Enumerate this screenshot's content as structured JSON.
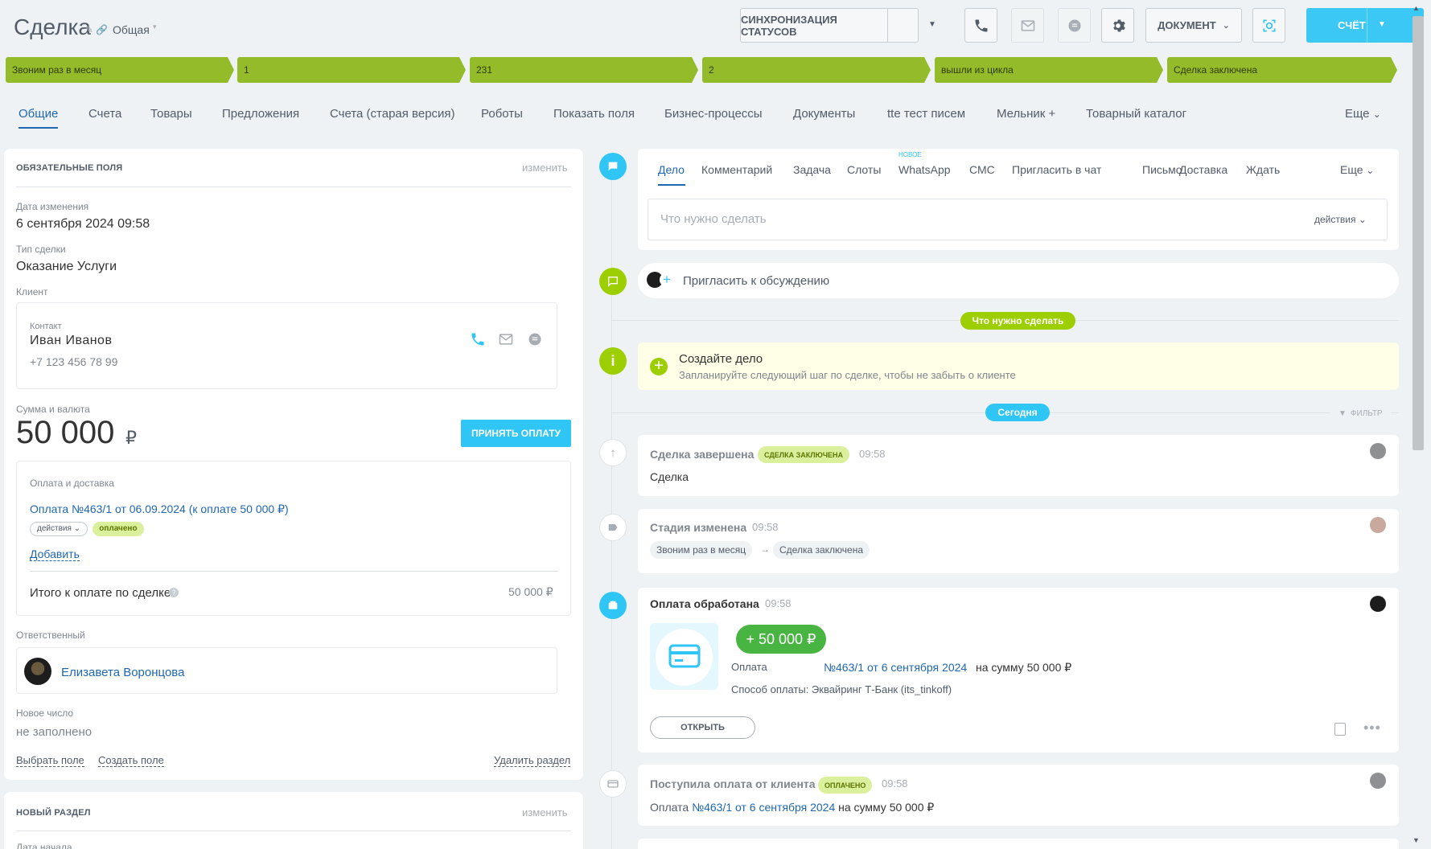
{
  "header": {
    "title": "Сделка",
    "category": "Общая",
    "sync_button": "СИНХРОНИЗАЦИЯ СТАТУСОВ",
    "document_button": "ДОКУМЕНТ",
    "invoice_button": "СЧЁТ"
  },
  "stages": [
    "Звоним раз в месяц",
    "1",
    "231",
    "2",
    "вышли из цикла",
    "Сделка заключена"
  ],
  "tabs": [
    "Общие",
    "Счета",
    "Товары",
    "Предложения",
    "Счета (старая версия)",
    "Роботы",
    "Показать поля",
    "Бизнес-процессы",
    "Документы",
    "tte тест писем",
    "Мельник +",
    "Товарный каталог"
  ],
  "tabs_more": "Еще",
  "left": {
    "section_title": "ОБЯЗАТЕЛЬНЫЕ ПОЛЯ",
    "edit_link": "изменить",
    "date_label": "Дата изменения",
    "date_value": "6 сентября 2024 09:58",
    "type_label": "Тип сделки",
    "type_value": "Оказание Услуги",
    "client_label": "Клиент",
    "contact_label": "Контакт",
    "contact_name": "Иван Иванов",
    "contact_phone": "+7 123 456 78 99",
    "sum_label": "Сумма и валюта",
    "sum_value": "50 000",
    "currency": "₽",
    "accept_button": "ПРИНЯТЬ ОПЛАТУ",
    "payment_title": "Оплата и доставка",
    "payment_link": "Оплата №463/1 от 06.09.2024 (к оплате 50 000 ₽)",
    "actions_pill": "действия",
    "paid_pill": "оплачено",
    "add_link": "Добавить",
    "total_label": "Итого к оплате по сделке",
    "total_value": "50 000 ₽",
    "responsible_label": "Ответственный",
    "responsible_name": "Елизавета Воронцова",
    "new_number_label": "Новое число",
    "new_number_value": "не заполнено",
    "choose_field": "Выбрать поле",
    "create_field": "Создать поле",
    "delete_section": "Удалить раздел",
    "new_section_title": "НОВЫЙ РАЗДЕЛ",
    "new_section_edit": "изменить",
    "partial_label": "Дата начала"
  },
  "activity": {
    "tabs": [
      "Дело",
      "Комментарий",
      "Задача",
      "Слоты",
      "WhatsApp",
      "СМС",
      "Пригласить в чат",
      "Письмо",
      "Доставка",
      "Ждать"
    ],
    "new_label": "НОВОЕ",
    "more": "Еще",
    "placeholder": "Что нужно сделать",
    "actions": "действия"
  },
  "timeline": {
    "invite": "Пригласить к обсуждению",
    "todo_badge": "Что нужно сделать",
    "create_title": "Создайте дело",
    "create_sub": "Запланируйте следующий шаг по сделке, чтобы не забыть о клиенте",
    "today_badge": "Сегодня",
    "filter": "ФИЛЬТР",
    "events": {
      "deal_done": {
        "title": "Сделка завершена",
        "pill": "СДЕЛКА ЗАКЛЮЧЕНА",
        "time": "09:58",
        "body": "Сделка"
      },
      "stage_changed": {
        "title": "Стадия изменена",
        "time": "09:58",
        "from": "Звоним раз в месяц",
        "to": "Сделка заключена"
      },
      "payment_processed": {
        "title": "Оплата обработана",
        "time": "09:58",
        "amount": "+ 50 000 ₽",
        "pay_label": "Оплата",
        "pay_link": "№463/1 от 6 сентября 2024",
        "pay_suffix": "на сумму",
        "pay_sum": "50 000",
        "pay_cur": "₽",
        "method": "Способ оплаты: Эквайринг Т-Банк (its_tinkoff)",
        "open_button": "ОТКРЫТЬ"
      },
      "payment_received": {
        "title": "Поступила оплата от клиента",
        "pill": "ОПЛАЧЕНО",
        "time": "09:58",
        "prefix": "Оплата",
        "link": "№463/1 от 6 сентября 2024",
        "suffix": "на сумму",
        "sum": "50 000",
        "cur": "₽"
      }
    }
  },
  "colors": {
    "accent": "#2fc6f6",
    "stage": "#94bc2a",
    "link": "#2067b0",
    "green": "#9dcf00"
  }
}
